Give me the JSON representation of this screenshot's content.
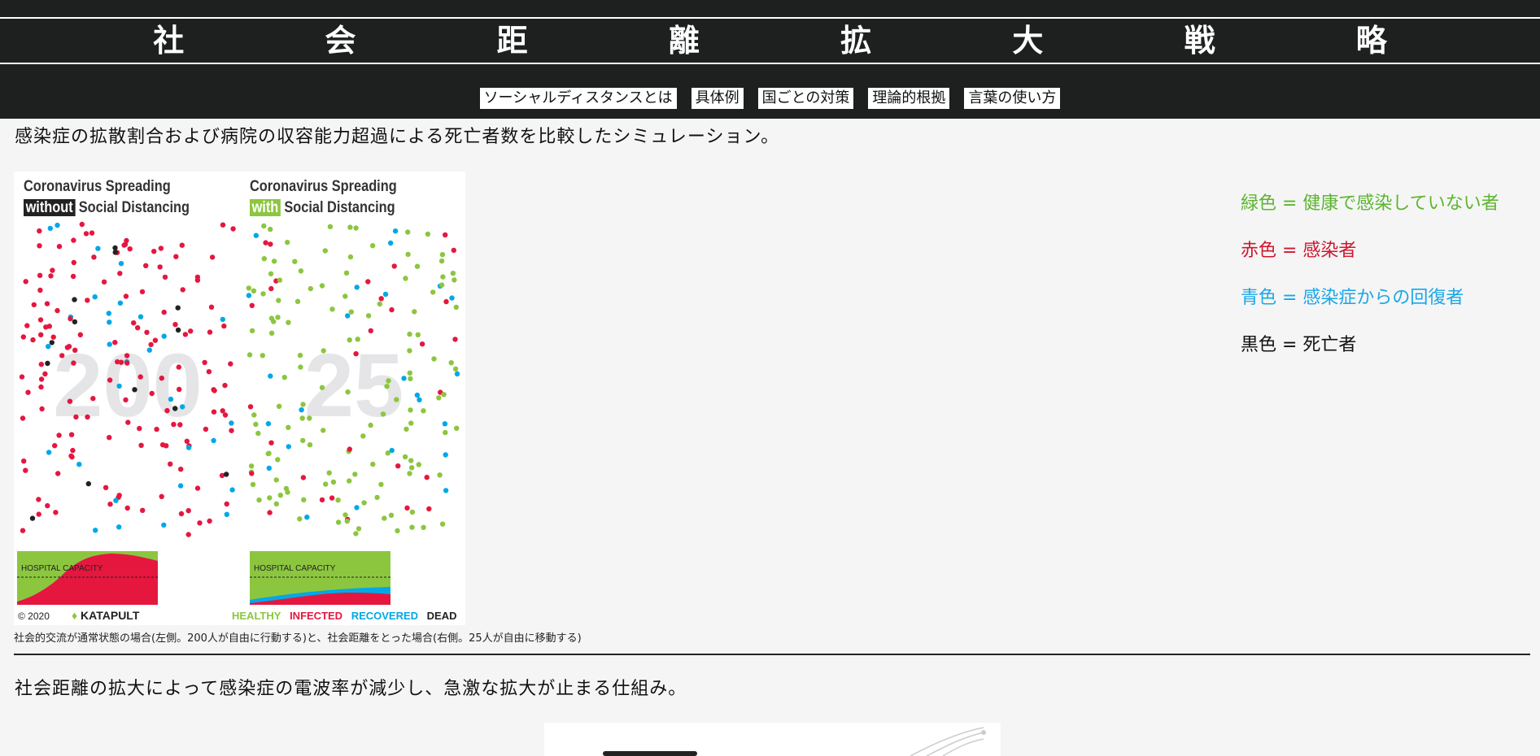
{
  "site": {
    "title": "社 会 距 離 拡 大 戦 略"
  },
  "nav": [
    {
      "label": "ソーシャルディスタンスとは"
    },
    {
      "label": "具体例"
    },
    {
      "label": "国ごとの対策"
    },
    {
      "label": "理論的根拠"
    },
    {
      "label": "言葉の使い方"
    }
  ],
  "section1": {
    "intro": "感染症の拡散割合および病院の収容能力超過による死亡者数を比較したシミュレーション。",
    "figure": {
      "left_panel": {
        "title_line1": "Coronavirus Spreading",
        "highlight": "without",
        "title_rest": "Social Distancing",
        "count": "200",
        "capacity_label": "HOSPITAL CAPACITY"
      },
      "right_panel": {
        "title_line1": "Coronavirus Spreading",
        "highlight": "with",
        "title_rest": "Social Distancing",
        "count": "25",
        "capacity_label": "HOSPITAL CAPACITY"
      },
      "copyright": "© 2020",
      "brand": "KATAPULT",
      "legend": [
        {
          "label": "HEALTHY",
          "color": "#8cc63f"
        },
        {
          "label": "INFECTED",
          "color": "#e5173f"
        },
        {
          "label": "RECOVERED",
          "color": "#00a8e8"
        },
        {
          "label": "DEAD",
          "color": "#222222"
        }
      ]
    },
    "caption": "社会的交流が通常状態の場合(左側。200人が自由に行動する)と、社会距離をとった場合(右側。25人が自由に移動する)",
    "side_legend": [
      {
        "text": "緑色 = 健康で感染していない者",
        "color": "#5cb531"
      },
      {
        "text": "赤色 = 感染者",
        "color": "#d0162e"
      },
      {
        "text": "青色 = 感染症からの回復者",
        "color": "#1aa7e6"
      },
      {
        "text": "黒色 = 死亡者",
        "color": "#111111"
      }
    ]
  },
  "section2": {
    "intro": "社会距離の拡大によって感染症の電波率が減少し、急激な拡大が止まる仕組み。"
  }
}
